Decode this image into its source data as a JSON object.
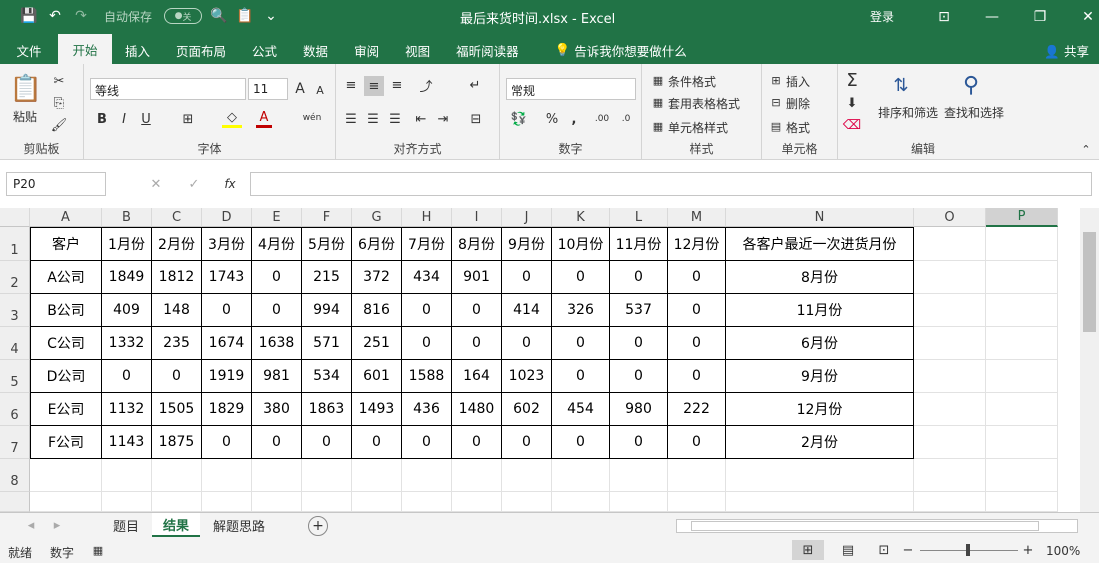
{
  "window": {
    "title": "最后来货时间.xlsx - Excel",
    "login": "登录",
    "autosave": "自动保存",
    "autosave_state": "关",
    "min": "—",
    "restore": "❐",
    "close": "✕"
  },
  "tabs": [
    "文件",
    "开始",
    "插入",
    "页面布局",
    "公式",
    "数据",
    "审阅",
    "视图",
    "福昕阅读器"
  ],
  "tell_me": "告诉我你想要做什么",
  "share": "共享",
  "ribbon": {
    "clipboard": {
      "label": "剪贴板",
      "paste": "粘贴"
    },
    "font": {
      "label": "字体",
      "name": "等线",
      "size": "11",
      "bold": "B",
      "italic": "I",
      "underline": "U",
      "grow": "A",
      "shrink": "A",
      "wen": "wén"
    },
    "align": {
      "label": "对齐方式"
    },
    "number": {
      "label": "数字",
      "format": "常规",
      "percent": "%",
      "comma": ","
    },
    "styles": {
      "label": "样式",
      "cond": "条件格式",
      "table": "套用表格格式",
      "cell": "单元格样式"
    },
    "cells": {
      "label": "单元格",
      "insert": "插入",
      "delete": "删除",
      "format": "格式"
    },
    "edit": {
      "label": "编辑",
      "sort": "排序和筛选",
      "find": "查找和选择"
    }
  },
  "formula_bar": {
    "name_box": "P20",
    "fx": "fx",
    "content": ""
  },
  "columns": [
    "A",
    "B",
    "C",
    "D",
    "E",
    "F",
    "G",
    "H",
    "I",
    "J",
    "K",
    "L",
    "M",
    "N",
    "O",
    "P"
  ],
  "rows": [
    "1",
    "2",
    "3",
    "4",
    "5",
    "6",
    "7",
    "8"
  ],
  "table": [
    [
      "客户",
      "1月份",
      "2月份",
      "3月份",
      "4月份",
      "5月份",
      "6月份",
      "7月份",
      "8月份",
      "9月份",
      "10月份",
      "11月份",
      "12月份",
      "各客户最近一次进货月份"
    ],
    [
      "A公司",
      "1849",
      "1812",
      "1743",
      "0",
      "215",
      "372",
      "434",
      "901",
      "0",
      "0",
      "0",
      "0",
      "8月份"
    ],
    [
      "B公司",
      "409",
      "148",
      "0",
      "0",
      "994",
      "816",
      "0",
      "0",
      "414",
      "326",
      "537",
      "0",
      "11月份"
    ],
    [
      "C公司",
      "1332",
      "235",
      "1674",
      "1638",
      "571",
      "251",
      "0",
      "0",
      "0",
      "0",
      "0",
      "0",
      "6月份"
    ],
    [
      "D公司",
      "0",
      "0",
      "1919",
      "981",
      "534",
      "601",
      "1588",
      "164",
      "1023",
      "0",
      "0",
      "0",
      "9月份"
    ],
    [
      "E公司",
      "1132",
      "1505",
      "1829",
      "380",
      "1863",
      "1493",
      "436",
      "1480",
      "602",
      "454",
      "980",
      "222",
      "12月份"
    ],
    [
      "F公司",
      "1143",
      "1875",
      "0",
      "0",
      "0",
      "0",
      "0",
      "0",
      "0",
      "0",
      "0",
      "0",
      "2月份"
    ]
  ],
  "sheets": [
    "题目",
    "结果",
    "解题思路"
  ],
  "active_sheet": "结果",
  "status": {
    "ready": "就绪",
    "mode": "数字",
    "zoom": "100%"
  }
}
